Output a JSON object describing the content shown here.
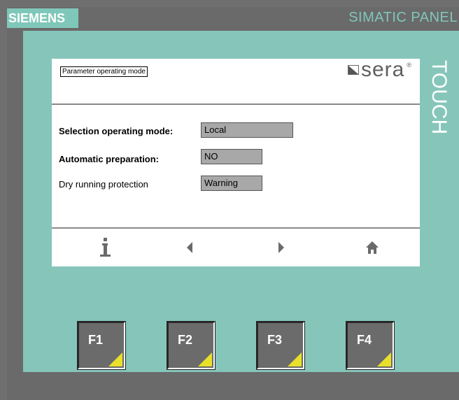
{
  "device": {
    "brand": "SIEMENS",
    "panel_label": "SIMATIC PANEL",
    "touch_label": "TOUCH"
  },
  "screen": {
    "title": "Parameter operating mode",
    "logo_text": "sera",
    "logo_reg": "®",
    "rows": [
      {
        "label": "Selection operating mode:",
        "value": "Local"
      },
      {
        "label": "Automatic preparation:",
        "value": "NO"
      },
      {
        "label": "Dry running protection",
        "value": "Warning"
      }
    ],
    "nav": {
      "info_icon": "info-icon",
      "prev_icon": "arrow-left-icon",
      "next_icon": "arrow-right-icon",
      "home_icon": "home-icon"
    }
  },
  "function_keys": [
    {
      "label": "F1"
    },
    {
      "label": "F2"
    },
    {
      "label": "F3"
    },
    {
      "label": "F4"
    }
  ],
  "colors": {
    "bezel": "#86c6ba",
    "frame": "#6a6a6a",
    "field": "#a8a8a8",
    "key_corner": "#e8e02a"
  }
}
